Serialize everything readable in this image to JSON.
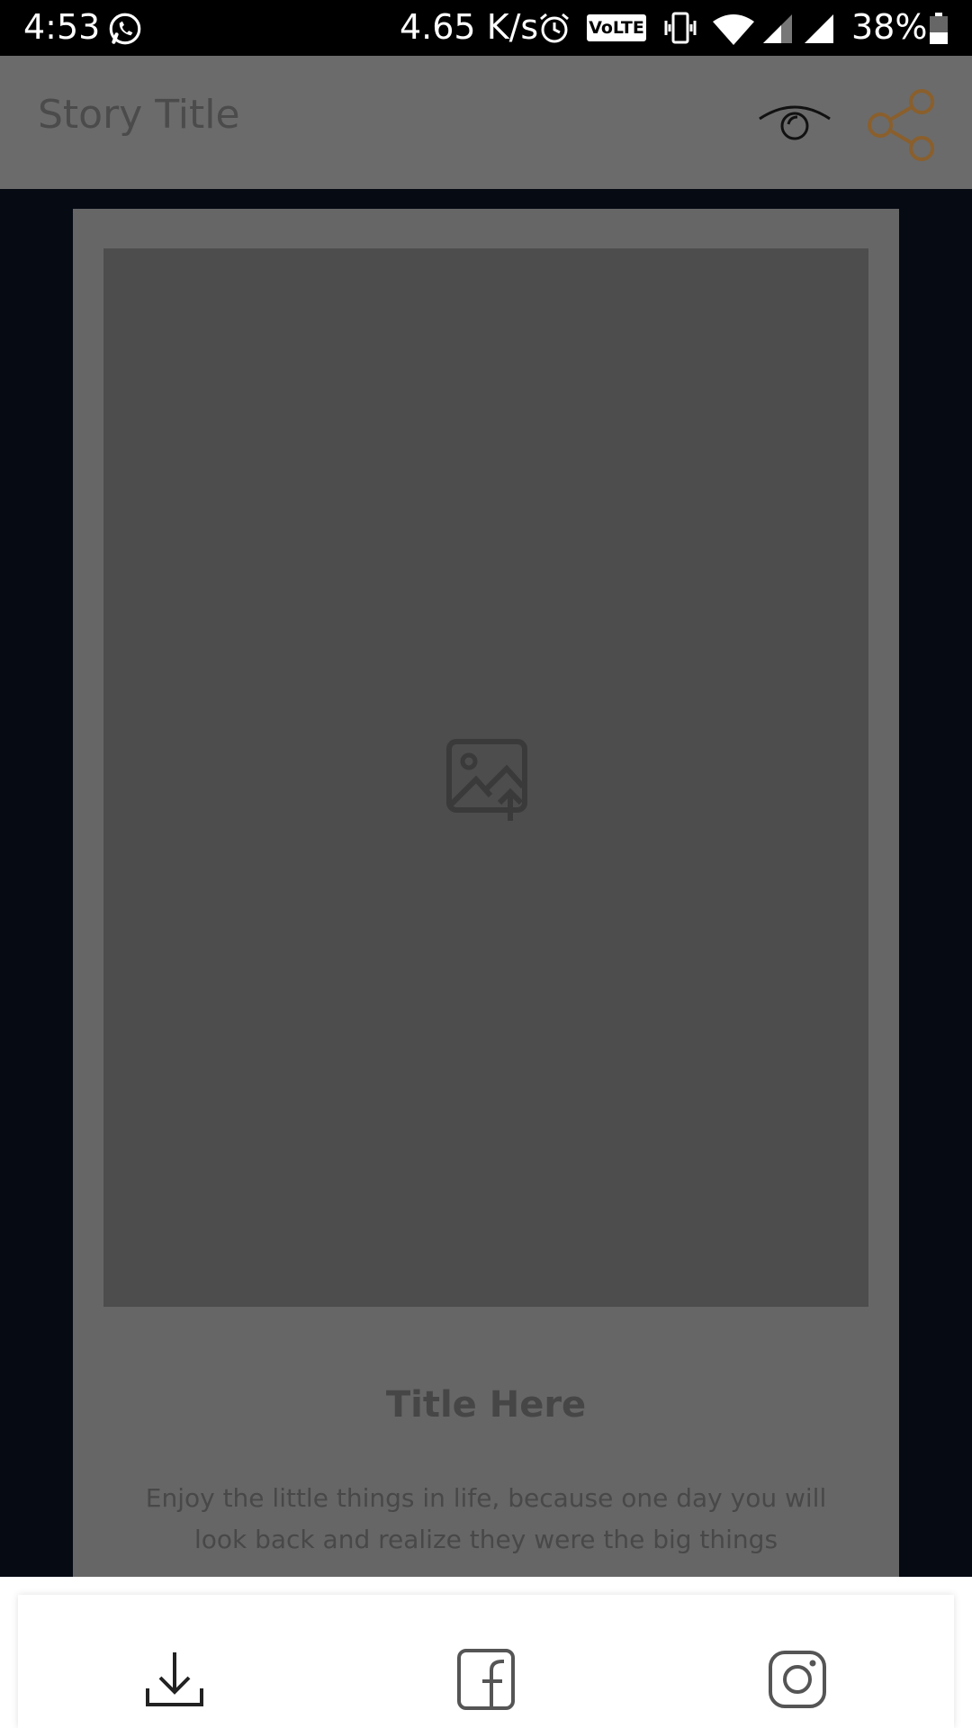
{
  "status_bar": {
    "time": "4:53",
    "network_speed": "4.65 K/s",
    "volte_label": "VoLTE",
    "battery_percent": "38%",
    "icons": [
      "whatsapp-icon",
      "alarm-icon",
      "volte-icon",
      "vibrate-icon",
      "wifi-icon",
      "signal-icon",
      "signal-icon",
      "battery-icon"
    ]
  },
  "app_bar": {
    "title": "Story Title",
    "actions": [
      "eye-icon",
      "share-icon"
    ],
    "share_color": "#8a5f2c"
  },
  "card": {
    "image_placeholder_icon": "image-upload-icon",
    "title": "Title Here",
    "text": "Enjoy the little things in life, because one day you will look back and realize they were the big things"
  },
  "bottom_sheet": {
    "actions": [
      "download-icon",
      "facebook-icon",
      "instagram-icon"
    ]
  },
  "colors": {
    "overlay_bg": "#050a13",
    "card_bg": "#666666",
    "image_bg": "#4d4d4d",
    "app_bar_bg": "#6b6b6b"
  }
}
